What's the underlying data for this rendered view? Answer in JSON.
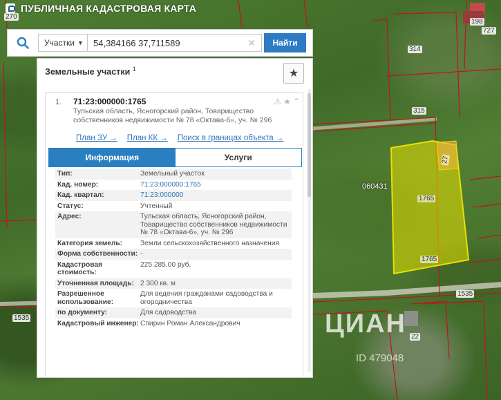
{
  "app": {
    "title": "ПУБЛИЧНАЯ КАДАСТРОВАЯ КАРТА"
  },
  "map": {
    "labels": [
      "270",
      "198",
      "727",
      "314",
      "315",
      "060431",
      "1765",
      "1765",
      "1535",
      "1535",
      "22",
      "27"
    ],
    "watermark": "ЦИАН",
    "watermark_id": "ID 479048"
  },
  "search": {
    "type_label": "Участки",
    "query": "54,384166 37,711589",
    "find_label": "Найти",
    "icon": "search-icon"
  },
  "panel": {
    "title": "Земельные участки",
    "count": "1",
    "result": {
      "number": "1.",
      "cad_id": "71:23:000000:1765",
      "address": "Тульская область, Ясногорский район, Товарищество собственников недвижимости № 78 «Октава-6», уч. № 296",
      "links": [
        "План ЗУ →",
        "План КК →",
        "Поиск в границах объекта →"
      ]
    },
    "tabs": [
      "Информация",
      "Услуги"
    ],
    "rows": [
      {
        "k": "Тип:",
        "v": "Земельный участок",
        "link": false
      },
      {
        "k": "Кад. номер:",
        "v": "71:23:000000:1765",
        "link": true
      },
      {
        "k": "Кад. квартал:",
        "v": "71:23:000000",
        "link": true
      },
      {
        "k": "Статус:",
        "v": "Учтенный",
        "link": false
      },
      {
        "k": "Адрес:",
        "v": "Тульская область, Ясногорский район, Товарищество собственников недвижимости № 78 «Октава-6», уч. № 296",
        "link": false
      },
      {
        "k": "Категория земель:",
        "v": "Земли сельскохозяйственного назначения",
        "link": false
      },
      {
        "k": "Форма собственности:",
        "v": "-",
        "link": false
      },
      {
        "k": "Кадастровая стоимость:",
        "v": "225 285,00 руб.",
        "link": false
      },
      {
        "k": "Уточненная площадь:",
        "v": "2 300 кв. м",
        "link": false
      },
      {
        "k": "Разрешенное использование:",
        "v": "Для ведения гражданами садоводства и огородничества",
        "link": false
      },
      {
        "k": "по документу:",
        "v": "Для садоводства",
        "link": false
      },
      {
        "k": "Кадастровый инженер:",
        "v": "Спирин Роман Александрович",
        "link": false
      }
    ]
  },
  "colors": {
    "accent": "#2a7fc0",
    "link": "#2f73b8",
    "parcel_highlight": "#e8e000",
    "boundary": "#c0141e"
  }
}
